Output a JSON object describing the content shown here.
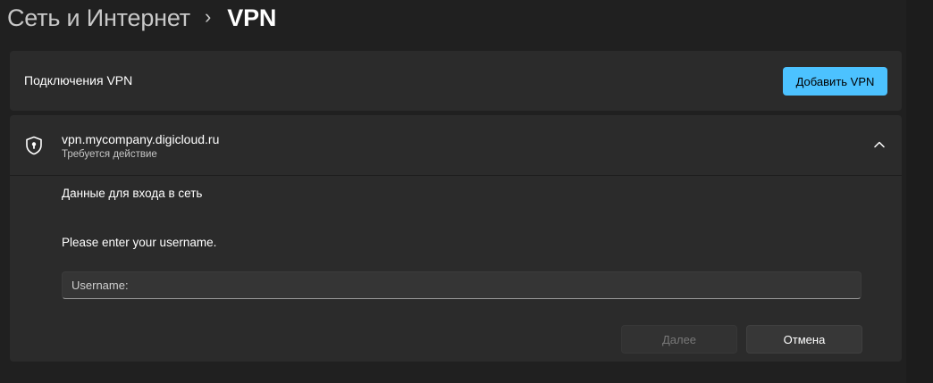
{
  "breadcrumb": {
    "parent": "Сеть и Интернет",
    "separator": "›",
    "current": "VPN"
  },
  "vpn_connections": {
    "label": "Подключения VPN",
    "add_button": "Добавить VPN"
  },
  "vpn_item": {
    "name": "vpn.mycompany.digicloud.ru",
    "status": "Требуется действие",
    "icon": "shield-lock-icon",
    "expanded": true,
    "sign_in": {
      "title": "Данные для входа в сеть",
      "prompt": "Please enter your username.",
      "username_placeholder": "Username:",
      "username_value": "",
      "next_button": "Далее",
      "next_enabled": false,
      "cancel_button": "Отмена"
    }
  },
  "colors": {
    "background": "#202020",
    "card": "#2b2b2b",
    "accent": "#4cc2ff"
  }
}
